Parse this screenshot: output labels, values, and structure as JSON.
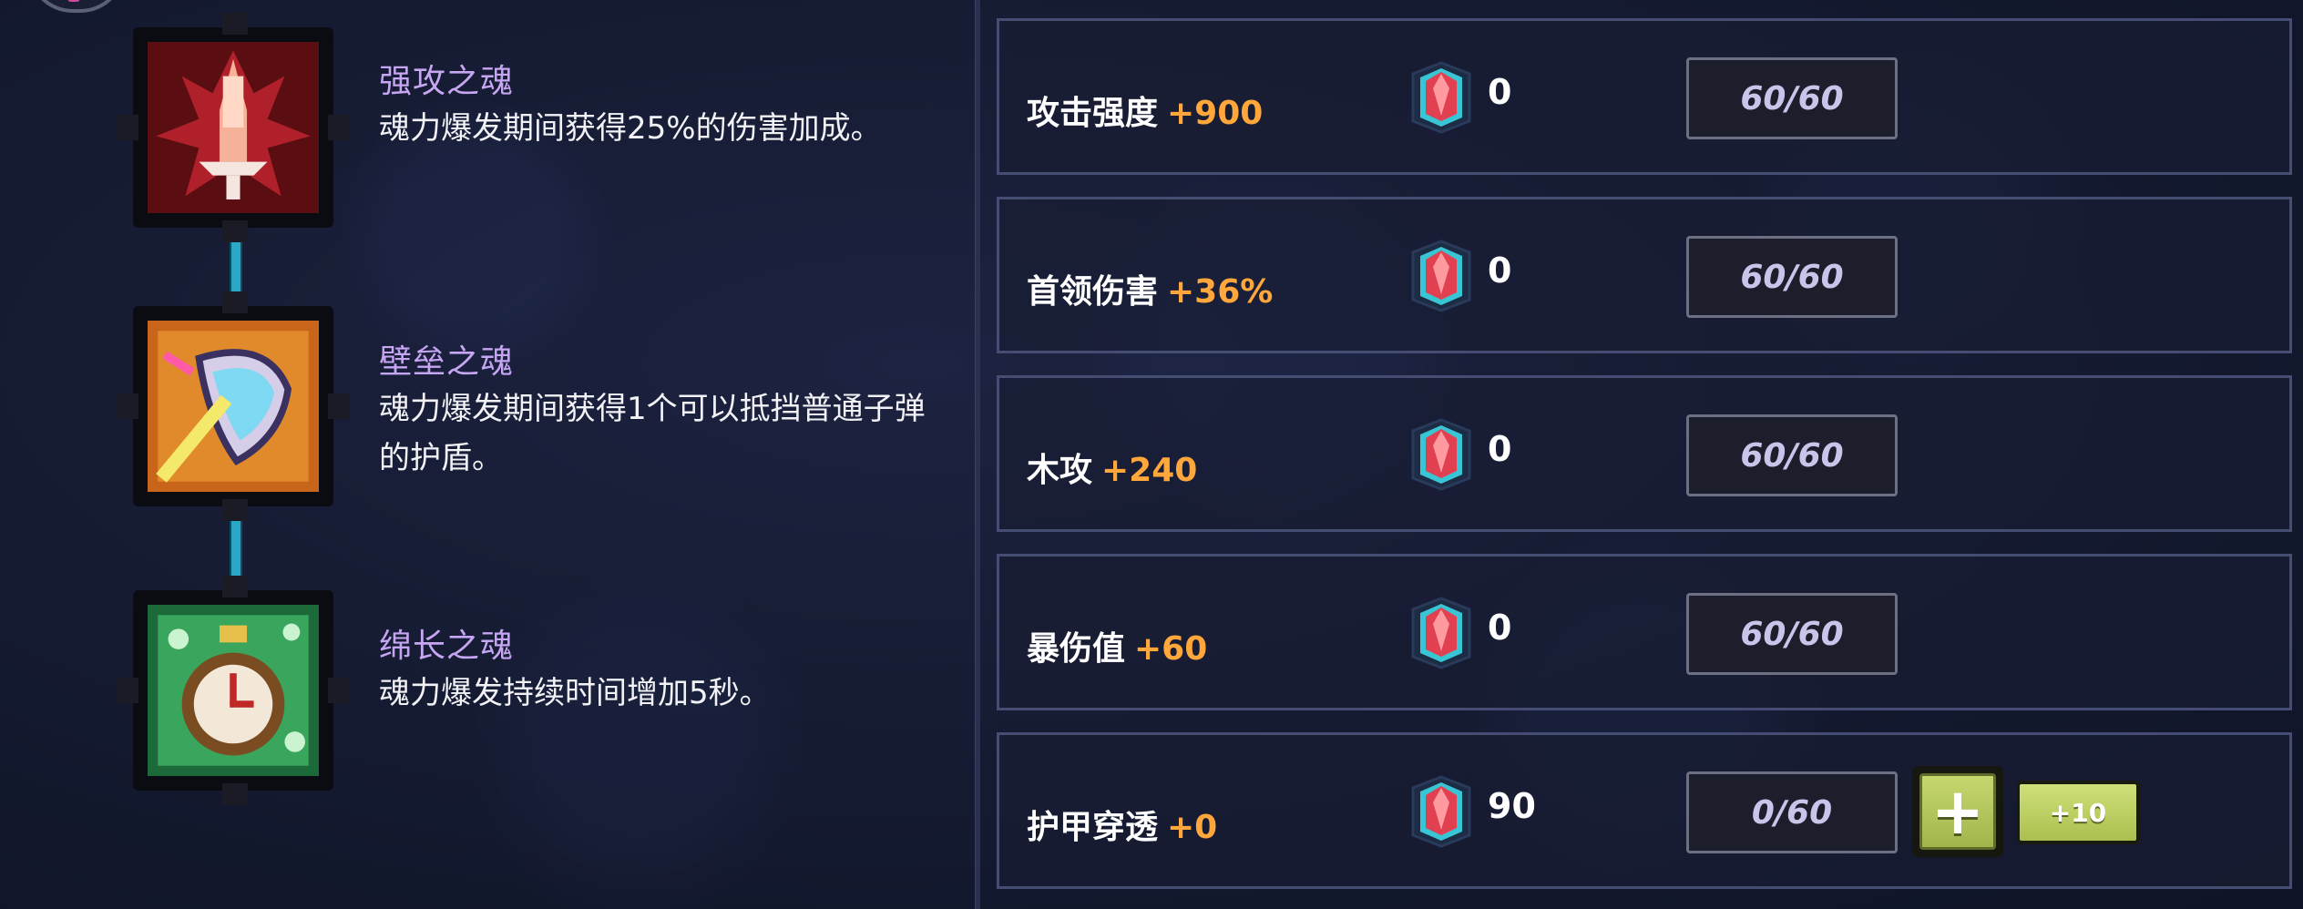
{
  "souls": [
    {
      "name": "强攻之魂",
      "description": "魂力爆发期间获得25%的伤害加成。"
    },
    {
      "name": "壁垒之魂",
      "description": "魂力爆发期间获得1个可以抵挡普通子弹的护盾。"
    },
    {
      "name": "绵长之魂",
      "description": "魂力爆发持续时间增加5秒。"
    }
  ],
  "stats": [
    {
      "label": "攻击强度",
      "bonus": "+900",
      "gem_count": "0",
      "progress": "60/60"
    },
    {
      "label": "首领伤害",
      "bonus": "+36%",
      "gem_count": "0",
      "progress": "60/60"
    },
    {
      "label": "木攻",
      "bonus": "+240",
      "gem_count": "0",
      "progress": "60/60"
    },
    {
      "label": "暴伤值",
      "bonus": "+60",
      "gem_count": "0",
      "progress": "60/60"
    },
    {
      "label": "护甲穿透",
      "bonus": "+0",
      "gem_count": "90",
      "progress": "0/60",
      "plus_label": "+",
      "plus10_label": "+10"
    }
  ],
  "colors": {
    "soul_name": "#c6a6f2",
    "bonus": "#ffa73a",
    "connector": "#2aa7c5",
    "button_green": "#b8ca60"
  },
  "icons": {
    "soul_1": "red-sword-flame-icon",
    "soul_2": "orange-shield-sword-icon",
    "soul_3": "green-stopwatch-icon",
    "gem": "red-gem-icon"
  }
}
